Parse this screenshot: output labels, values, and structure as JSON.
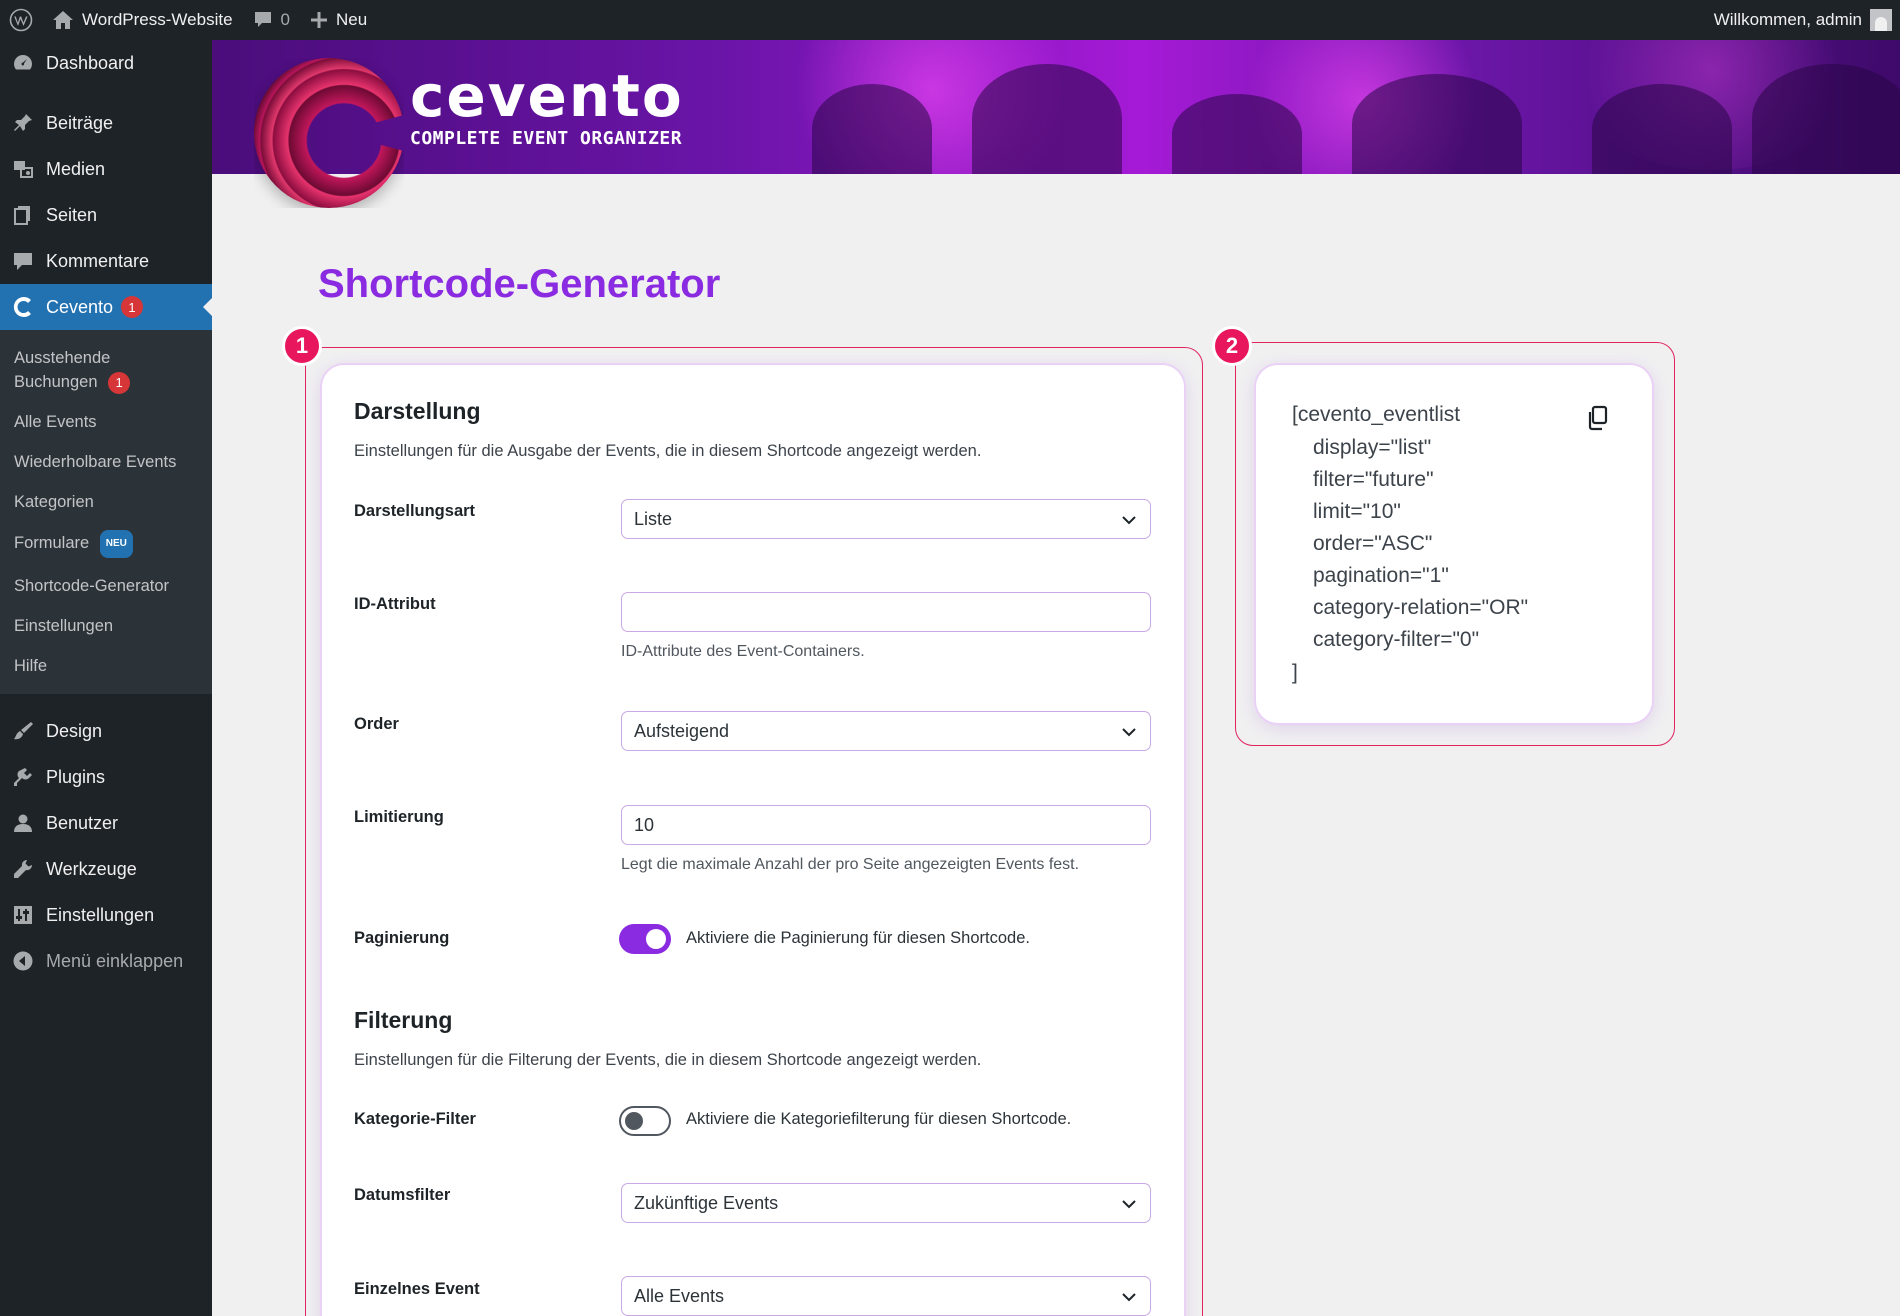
{
  "adminbar": {
    "site_name": "WordPress-Website",
    "comments_count": "0",
    "new_label": "Neu",
    "welcome": "Willkommen, admin"
  },
  "sidebar": {
    "dashboard": "Dashboard",
    "beitraege": "Beiträge",
    "medien": "Medien",
    "seiten": "Seiten",
    "kommentare": "Kommentare",
    "cevento": "Cevento",
    "cevento_badge": "1",
    "submenu": {
      "pending_line1": "Ausstehende",
      "pending_line2": "Buchungen",
      "pending_badge": "1",
      "all_events": "Alle Events",
      "recurring": "Wiederholbare Events",
      "categories": "Kategorien",
      "forms": "Formulare",
      "forms_badge": "NEU",
      "shortcode": "Shortcode-Generator",
      "settings": "Einstellungen",
      "help": "Hilfe"
    },
    "design": "Design",
    "plugins": "Plugins",
    "users": "Benutzer",
    "tools": "Werkzeuge",
    "settings": "Einstellungen",
    "collapse": "Menü einklappen"
  },
  "banner": {
    "logo_title": "cevento",
    "logo_subtitle": "COMPLETE EVENT ORGANIZER"
  },
  "page_title": "Shortcode-Generator",
  "annotations": [
    "1",
    "2"
  ],
  "darstellung": {
    "title": "Darstellung",
    "description": "Einstellungen für die Ausgabe der Events, die in diesem Shortcode angezeigt werden.",
    "display_label": "Darstellungsart",
    "display_value": "Liste",
    "id_label": "ID-Attribut",
    "id_value": "",
    "id_help": "ID-Attribute des Event-Containers.",
    "order_label": "Order",
    "order_value": "Aufsteigend",
    "limit_label": "Limitierung",
    "limit_value": "10",
    "limit_help": "Legt die maximale Anzahl der pro Seite angezeigten Events fest.",
    "pagination_label": "Paginierung",
    "pagination_text": "Aktiviere die Paginierung für diesen Shortcode.",
    "pagination_on": true
  },
  "filterung": {
    "title": "Filterung",
    "description": "Einstellungen für die Filterung der Events, die in diesem Shortcode angezeigt werden.",
    "category_label": "Kategorie-Filter",
    "category_text": "Aktiviere die Kategoriefilterung für diesen Shortcode.",
    "category_on": false,
    "date_label": "Datumsfilter",
    "date_value": "Zukünftige Events",
    "single_label": "Einzelnes Event",
    "single_value": "Alle Events"
  },
  "shortcode": {
    "lines": [
      "[cevento_eventlist",
      "display=\"list\"",
      "filter=\"future\"",
      "limit=\"10\"",
      "order=\"ASC\"",
      "pagination=\"1\"",
      "category-relation=\"OR\"",
      "category-filter=\"0\"",
      "]"
    ],
    "copy_icon": "copy-icon"
  },
  "colors": {
    "accent": "#8a2be2",
    "annotation": "#e0245e",
    "wp_blue": "#2271b1",
    "sidebar": "#1d2327"
  }
}
